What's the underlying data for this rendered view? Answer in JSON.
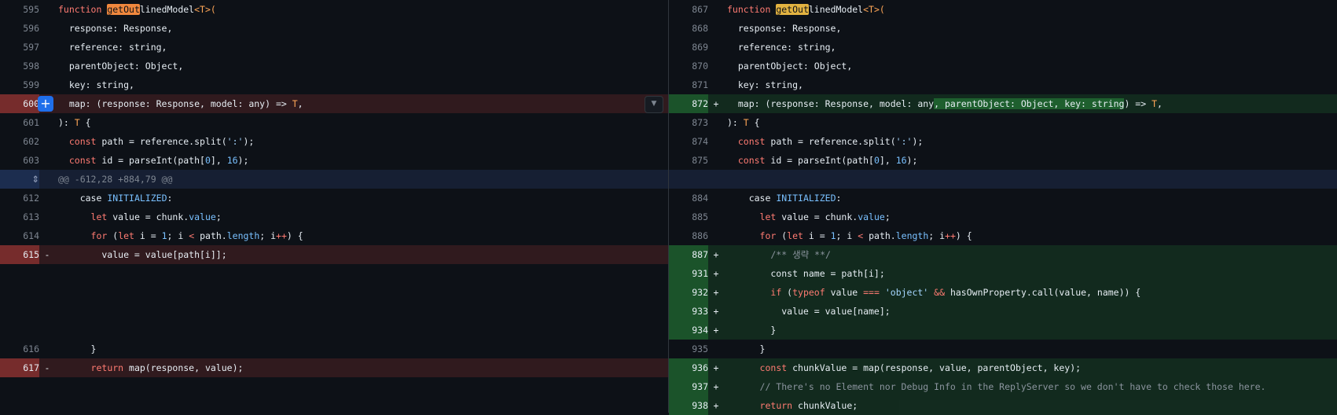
{
  "left": {
    "lines": [
      {
        "num": "595",
        "type": "ctx"
      },
      {
        "num": "596",
        "type": "ctx",
        "text": "  response: Response,"
      },
      {
        "num": "597",
        "type": "ctx",
        "text": "  reference: string,"
      },
      {
        "num": "598",
        "type": "ctx",
        "text": "  parentObject: Object,"
      },
      {
        "num": "599",
        "type": "ctx",
        "text": "  key: string,"
      },
      {
        "num": "600",
        "type": "del"
      },
      {
        "num": "601",
        "type": "ctx"
      },
      {
        "num": "602",
        "type": "ctx"
      },
      {
        "num": "603",
        "type": "ctx"
      },
      {
        "num": "",
        "type": "hunk",
        "text": "@@ -612,28 +884,79 @@"
      },
      {
        "num": "612",
        "type": "ctx"
      },
      {
        "num": "613",
        "type": "ctx"
      },
      {
        "num": "614",
        "type": "ctx"
      },
      {
        "num": "615",
        "type": "del",
        "marker": "-",
        "text": "        value = value[path[i]];"
      },
      {
        "num": "616",
        "type": "ctx",
        "text": "      }"
      },
      {
        "num": "617",
        "type": "del",
        "marker": "-"
      }
    ]
  },
  "right": {
    "lines": [
      {
        "num": "867"
      },
      {
        "num": "868",
        "text": "  response: Response,"
      },
      {
        "num": "869",
        "text": "  reference: string,"
      },
      {
        "num": "870",
        "text": "  parentObject: Object,"
      },
      {
        "num": "871",
        "text": "  key: string,"
      },
      {
        "num": "872",
        "marker": "+"
      },
      {
        "num": "873"
      },
      {
        "num": "874"
      },
      {
        "num": "875"
      },
      {
        "num": "884"
      },
      {
        "num": "885"
      },
      {
        "num": "886"
      },
      {
        "num": "887",
        "marker": "+",
        "text": "        /** 생략 **/"
      },
      {
        "num": "931",
        "marker": "+",
        "text": "        const name = path[i];"
      },
      {
        "num": "932",
        "marker": "+"
      },
      {
        "num": "933",
        "marker": "+",
        "text": "          value = value[name];"
      },
      {
        "num": "934",
        "marker": "+",
        "text": "        }"
      },
      {
        "num": "935",
        "text": "      }"
      },
      {
        "num": "936",
        "marker": "+"
      },
      {
        "num": "937",
        "marker": "+",
        "text": "      // There's no Element nor Debug Info in the ReplyServer so we don't have to check those here."
      },
      {
        "num": "938",
        "marker": "+"
      }
    ]
  },
  "code": {
    "fn_kw": "function",
    "fn_name_hl": "getOut",
    "fn_name_rest": "linedModel",
    "generic": "<T>(",
    "map_old": "  map: (response: Response, model: any) => ",
    "map_new_a": "  map: (response: Response, model: any",
    "map_new_b": ", parentObject: Object, key: string",
    "map_new_c": ") => ",
    "T": "T",
    "comma": ",",
    "ret_close": "): ",
    "ret_brace": " {",
    "const": "const",
    "path_line": " path = reference.split(",
    "path_str": "':'",
    "path_end": ");",
    "id_line": " id = parseInt(path[",
    "zero": "0",
    "id_mid": "], ",
    "sixteen": "16",
    "id_end": ");",
    "case_kw": "case",
    "initialized": "INITIALIZED",
    "colon": ":",
    "let_kw": "let",
    "value_line": " value = chunk.",
    "value_prop": "value",
    "semi": ";",
    "for_kw": "for",
    "for_a": " (",
    "for_b": " i = ",
    "one": "1",
    "for_c": "; i ",
    "lt": "<",
    "for_d": " path.",
    "length": "length",
    "for_e": "; i",
    "inc": "++",
    "for_f": ") {",
    "if_kw": "if",
    "typeof_kw": "typeof",
    "if_a": " (",
    "if_b": " value ",
    "eqeq": "===",
    "obj_str": "'object'",
    "and": "&&",
    "if_c": " hasOwnProperty.call(value, name)) {",
    "return_kw": "return",
    "ret_old": " map(response, value);",
    "chunk_line": " chunkValue = map(response, value, parentObject, key);",
    "ret_new": " chunkValue;"
  }
}
